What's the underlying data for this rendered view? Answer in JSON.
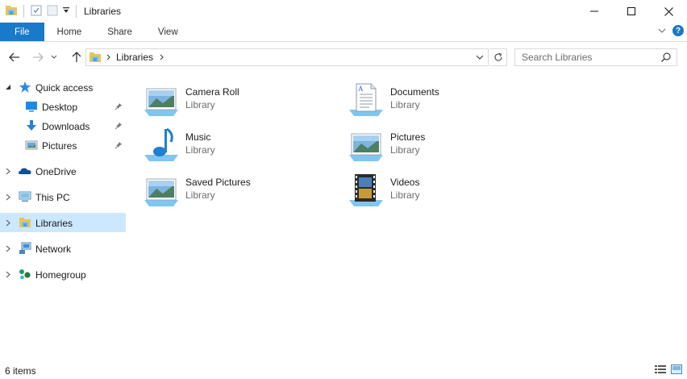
{
  "window": {
    "title": "Libraries"
  },
  "ribbon": {
    "tabs": [
      {
        "label": "File"
      },
      {
        "label": "Home"
      },
      {
        "label": "Share"
      },
      {
        "label": "View"
      }
    ]
  },
  "address": {
    "crumbs": [
      "Libraries"
    ]
  },
  "search": {
    "placeholder": "Search Libraries"
  },
  "sidebar": {
    "quick_access": {
      "label": "Quick access",
      "items": [
        {
          "label": "Desktop"
        },
        {
          "label": "Downloads"
        },
        {
          "label": "Pictures"
        }
      ]
    },
    "items": [
      {
        "label": "OneDrive"
      },
      {
        "label": "This PC"
      },
      {
        "label": "Libraries"
      },
      {
        "label": "Network"
      },
      {
        "label": "Homegroup"
      }
    ]
  },
  "libraries": [
    {
      "name": "Camera Roll",
      "type": "Library",
      "icon": "picture-library-icon"
    },
    {
      "name": "Documents",
      "type": "Library",
      "icon": "documents-library-icon"
    },
    {
      "name": "Music",
      "type": "Library",
      "icon": "music-library-icon"
    },
    {
      "name": "Pictures",
      "type": "Library",
      "icon": "picture-library-icon"
    },
    {
      "name": "Saved Pictures",
      "type": "Library",
      "icon": "picture-library-icon"
    },
    {
      "name": "Videos",
      "type": "Library",
      "icon": "videos-library-icon"
    }
  ],
  "status": {
    "item_count": "6 items"
  },
  "colors": {
    "accent": "#1979ca",
    "selection": "#cce8ff",
    "muted_text": "#6d6d6d"
  }
}
